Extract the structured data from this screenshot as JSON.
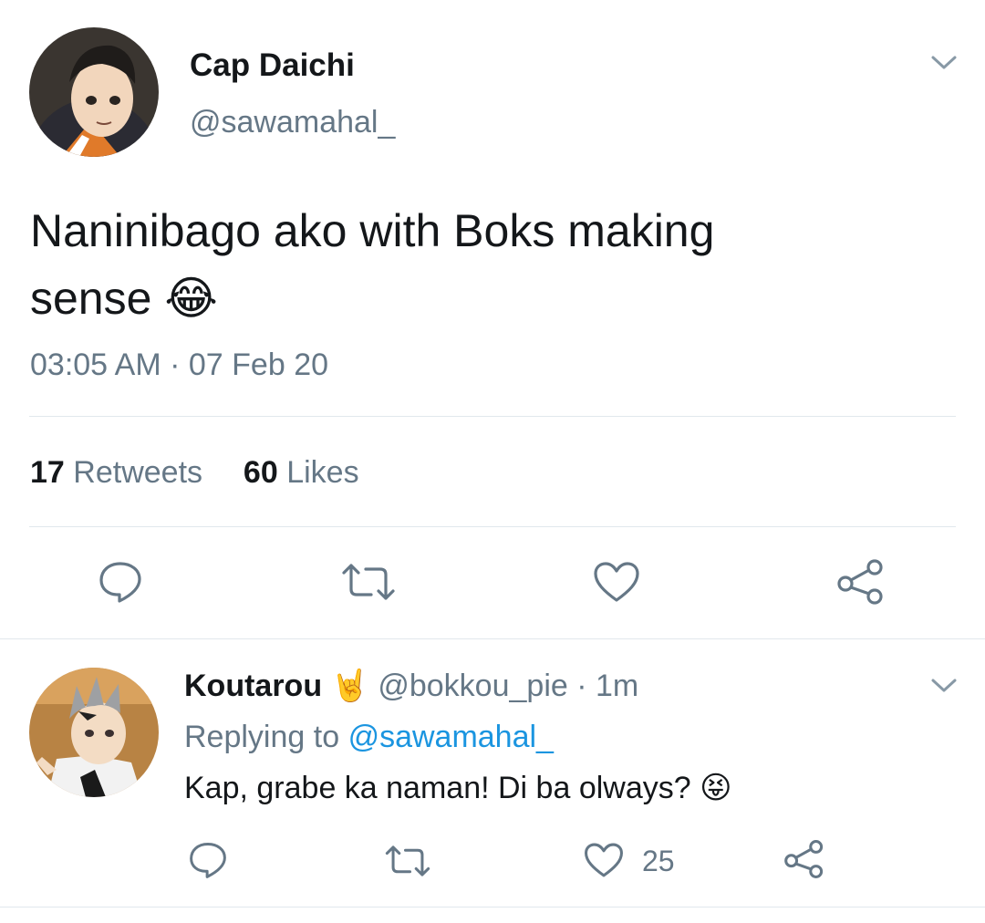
{
  "tweet": {
    "display_name": "Cap Daichi",
    "handle": "@sawamahal_",
    "text_line1": "Naninibago ako with Boks making",
    "text_line2": "sense",
    "emoji": "😂",
    "time": "03:05 AM",
    "dot": "·",
    "date": "07 Feb 20",
    "retweet_count": "17",
    "retweet_label": "Retweets",
    "like_count": "60",
    "like_label": "Likes"
  },
  "reply": {
    "display_name": "Koutarou",
    "name_emoji": "🤘",
    "handle": "@bokkou_pie",
    "dot_time": "· 1m",
    "replying_prefix": "Replying to",
    "replying_handle": "@sawamahal_",
    "text": "Kap, grabe ka naman! Di ba olways?",
    "emoji": "😝",
    "like_count": "25"
  },
  "colors": {
    "text": "#14171a",
    "muted": "#657786",
    "link": "#1b95e0",
    "divider": "#e1e8ed",
    "icon": "#657786"
  },
  "icons": [
    "chevron-down-icon",
    "reply-icon",
    "retweet-icon",
    "heart-icon",
    "share-icon"
  ]
}
